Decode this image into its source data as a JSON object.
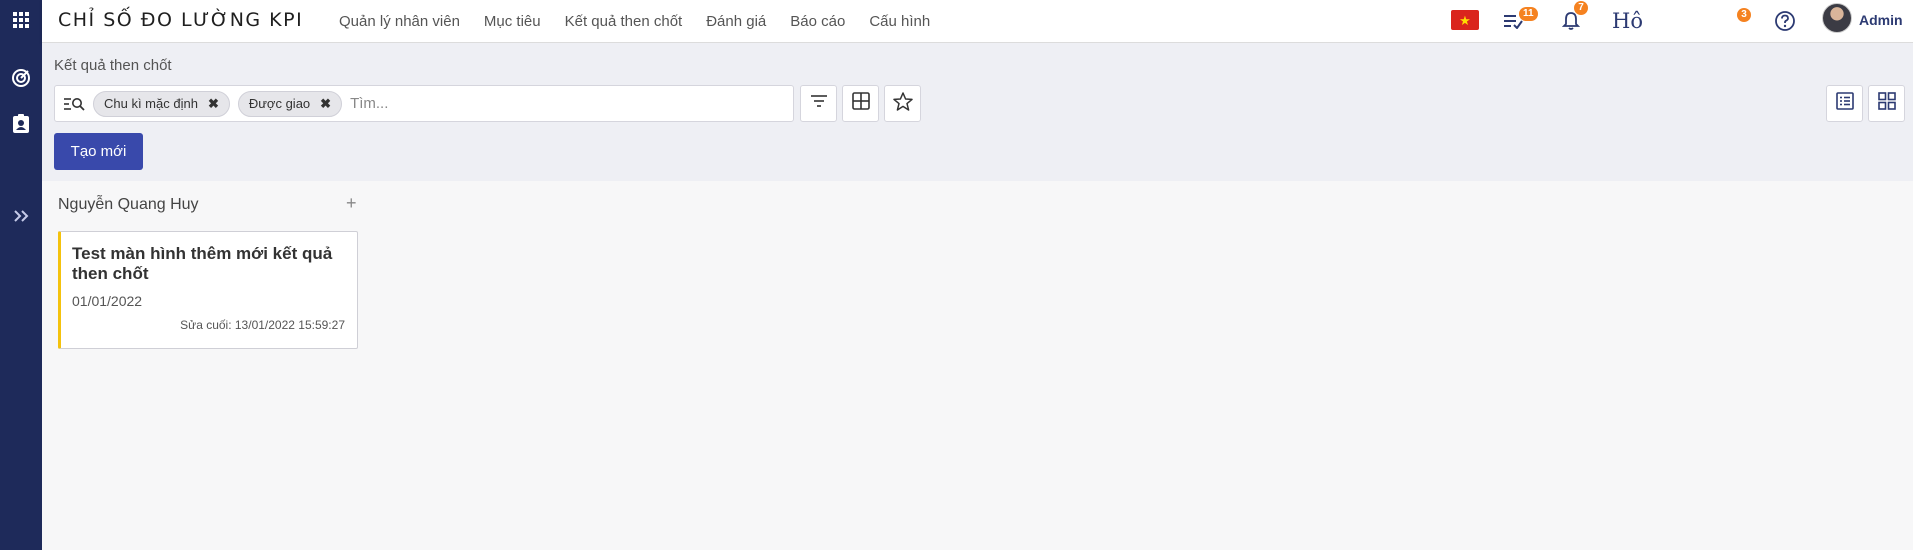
{
  "app": {
    "title": "CHỈ SỐ ĐO LƯỜNG KPI"
  },
  "menu": [
    {
      "label": "Quản lý nhân viên"
    },
    {
      "label": "Mục tiêu"
    },
    {
      "label": "Kết quả then chốt"
    },
    {
      "label": "Đánh giá"
    },
    {
      "label": "Báo cáo"
    },
    {
      "label": "Cấu hình"
    }
  ],
  "topbar": {
    "tasks_badge": "11",
    "notifications_badge": "7",
    "ho_text": "Hô",
    "chat_badge": "3",
    "user_name": "Admin"
  },
  "icons": {
    "rail": [
      "apps-grid-icon",
      "target-icon",
      "clipboard-user-icon",
      "expand-chevrons-icon"
    ],
    "topbar": [
      "vietnam-flag-icon",
      "task-list-icon",
      "bell-icon",
      "help-icon"
    ],
    "toolbar": [
      "filter-icon",
      "group-by-icon",
      "favorite-star-icon",
      "list-view-icon",
      "kanban-view-icon"
    ]
  },
  "colors": {
    "rail_bg": "#1e2a5a",
    "primary": "#3949ab",
    "badge": "#f58220",
    "card_accent": "#f4c20d"
  },
  "control_panel": {
    "breadcrumb": "Kết quả then chốt",
    "facets": [
      {
        "label": "Chu kì mặc định"
      },
      {
        "label": "Được giao"
      }
    ],
    "search_placeholder": "Tìm...",
    "create_label": "Tạo mới"
  },
  "kanban": {
    "columns": [
      {
        "title": "Nguyễn Quang Huy",
        "add_label": "+",
        "cards": [
          {
            "title": "Test màn hình thêm mới kết quả then chốt",
            "date": "01/01/2022",
            "last_modified": "Sửa cuối: 13/01/2022 15:59:27"
          }
        ]
      }
    ]
  }
}
